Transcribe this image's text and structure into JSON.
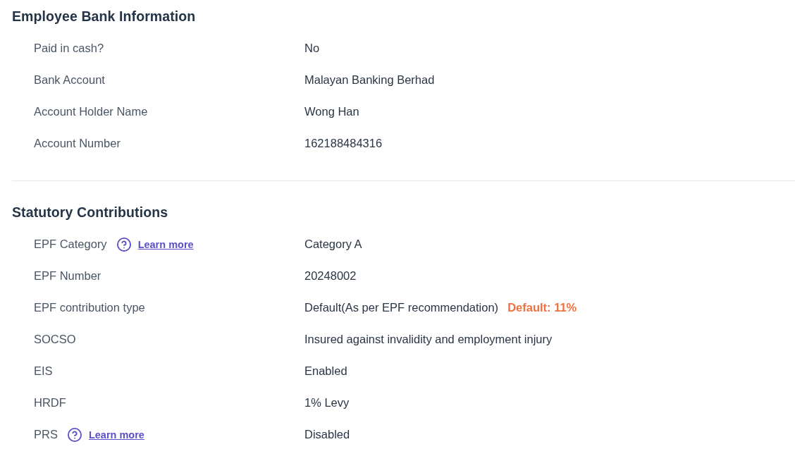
{
  "sections": [
    {
      "title": "Employee Bank Information",
      "fields": [
        {
          "label": "Paid in cash?",
          "value": "No"
        },
        {
          "label": "Bank Account",
          "value": "Malayan Banking Berhad"
        },
        {
          "label": "Account Holder Name",
          "value": "Wong Han"
        },
        {
          "label": "Account Number",
          "value": "162188484316"
        }
      ]
    },
    {
      "title": "Statutory Contributions",
      "fields": [
        {
          "label": "EPF Category",
          "help_link": "Learn more",
          "value": "Category A"
        },
        {
          "label": "EPF Number",
          "value": "20248002"
        },
        {
          "label": "EPF contribution type",
          "value": "Default(As per EPF recommendation)",
          "note": "Default: 11%"
        },
        {
          "label": "SOCSO",
          "value": "Insured against invalidity and employment injury"
        },
        {
          "label": "EIS",
          "value": "Enabled"
        },
        {
          "label": "HRDF",
          "value": "1% Levy"
        },
        {
          "label": "PRS",
          "help_link": "Learn more",
          "value": "Disabled"
        }
      ]
    }
  ]
}
